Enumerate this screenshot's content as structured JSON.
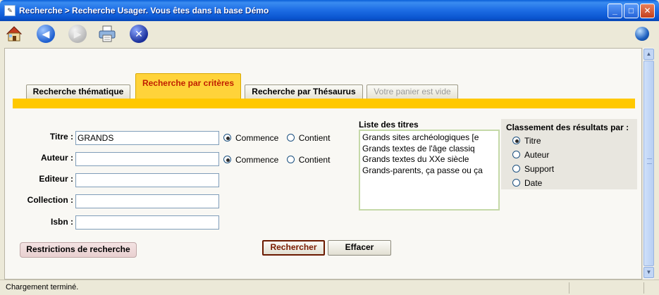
{
  "window": {
    "title": "Recherche > Recherche Usager.  Vous êtes dans la base Démo",
    "icon": "app-icon",
    "minimize": "_",
    "maximize": "□",
    "close": "✕"
  },
  "toolbar": {
    "buttons": [
      {
        "name": "home-icon"
      },
      {
        "name": "back-arrow-icon"
      },
      {
        "name": "forward-arrow-icon"
      },
      {
        "name": "printer-icon"
      },
      {
        "name": "stop-icon"
      }
    ],
    "right_icon": "globe-icon"
  },
  "tabs": [
    {
      "label": "Recherche thématique",
      "state": "normal"
    },
    {
      "label": "Recherche par critères",
      "state": "active"
    },
    {
      "label": "Recherche par Thésaurus",
      "state": "normal"
    },
    {
      "label": "Votre panier est vide",
      "state": "disabled"
    }
  ],
  "form": {
    "titre": {
      "label": "Titre :",
      "value": "GRANDS"
    },
    "auteur": {
      "label": "Auteur :",
      "value": ""
    },
    "editeur": {
      "label": "Editeur :",
      "value": ""
    },
    "collection": {
      "label": "Collection :",
      "value": ""
    },
    "isbn": {
      "label": "Isbn :",
      "value": ""
    },
    "match_options": {
      "commence": "Commence",
      "contient": "Contient"
    },
    "titre_match": "Commence",
    "auteur_match": "Commence"
  },
  "titles_list": {
    "heading": "Liste des titres",
    "items": [
      "Grands sites archéologiques [e",
      "Grands textes de l'âge classiq",
      "Grands textes du XXe siècle",
      "Grands-parents, ça passe ou ça"
    ]
  },
  "sort": {
    "heading": "Classement des résultats par :",
    "options": [
      "Titre",
      "Auteur",
      "Support",
      "Date"
    ],
    "selected": "Titre"
  },
  "buttons": {
    "restrictions": "Restrictions de recherche",
    "search": "Rechercher",
    "clear": "Effacer"
  },
  "status": {
    "text": "Chargement terminé."
  },
  "colors": {
    "tab_active": "#ffd33a",
    "tab_strip": "#ffc800",
    "titlebar": "#1f6fe6"
  }
}
